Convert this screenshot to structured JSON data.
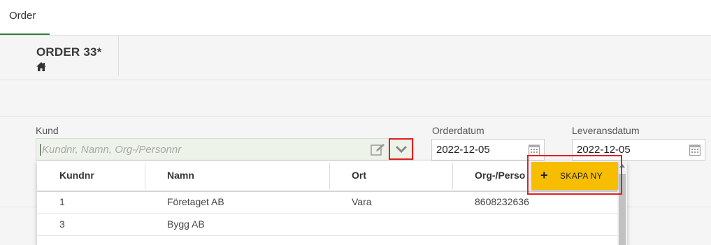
{
  "tabs": [
    {
      "label": "Order",
      "active": true
    }
  ],
  "header": {
    "title": "ORDER 33*",
    "home_icon": "home-icon"
  },
  "form": {
    "kund": {
      "label": "Kund",
      "placeholder": "Kundnr, Namn, Org-/Personnr",
      "value": ""
    },
    "orderdatum": {
      "label": "Orderdatum",
      "value": "2022-12-05"
    },
    "leveransdatum": {
      "label": "Leveransdatum",
      "value": "2022-12-05"
    }
  },
  "dropdown": {
    "columns": [
      "Kundnr",
      "Namn",
      "Ort",
      "Org-/Perso"
    ],
    "rows": [
      {
        "kundnr": "1",
        "namn": "Företaget AB",
        "ort": "Vara",
        "org": "8608232636"
      },
      {
        "kundnr": "3",
        "namn": "Bygg AB",
        "ort": "",
        "org": ""
      }
    ],
    "create_button": "SKAPA NY"
  },
  "colors": {
    "accent_green": "#2e7d32",
    "button_yellow": "#f7bd00",
    "highlight_red": "#e02020"
  }
}
